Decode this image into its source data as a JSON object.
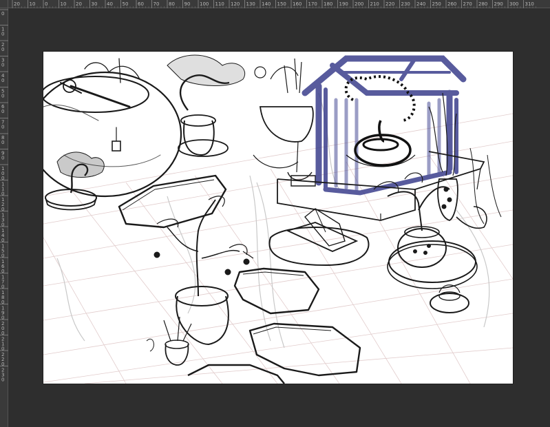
{
  "ruler": {
    "top_labels": [
      "20",
      "10",
      "0",
      "10",
      "20",
      "30",
      "40",
      "50",
      "60",
      "70",
      "80",
      "90",
      "100",
      "110",
      "120",
      "130",
      "140",
      "150",
      "160",
      "170",
      "180",
      "190",
      "200",
      "210",
      "220",
      "230",
      "240",
      "250",
      "260",
      "270",
      "280",
      "290",
      "300",
      "310"
    ],
    "left_labels": [
      "0",
      "10",
      "20",
      "30",
      "40",
      "50",
      "60",
      "70",
      "80",
      "90",
      "100",
      "110",
      "120",
      "130",
      "140",
      "150",
      "160",
      "170",
      "180",
      "190",
      "200",
      "210",
      "220",
      "230"
    ]
  },
  "colors": {
    "workspace": "#2e2e2e",
    "ruler_bg": "#3a3a3a",
    "ruler_text": "#b8b8b8",
    "canvas": "#ffffff",
    "sketch_ink": "#1a1a1a",
    "guide_grid": "#d9b9b9",
    "shrine_color": "#3b3f8c"
  },
  "artwork": {
    "subject": "garden-sketch",
    "elements": [
      "glass-bowl-planter",
      "bonsai-pot",
      "flower-basket",
      "shrine-house",
      "stepping-stones",
      "potted-shrubs",
      "crystal-on-pedestal"
    ]
  }
}
